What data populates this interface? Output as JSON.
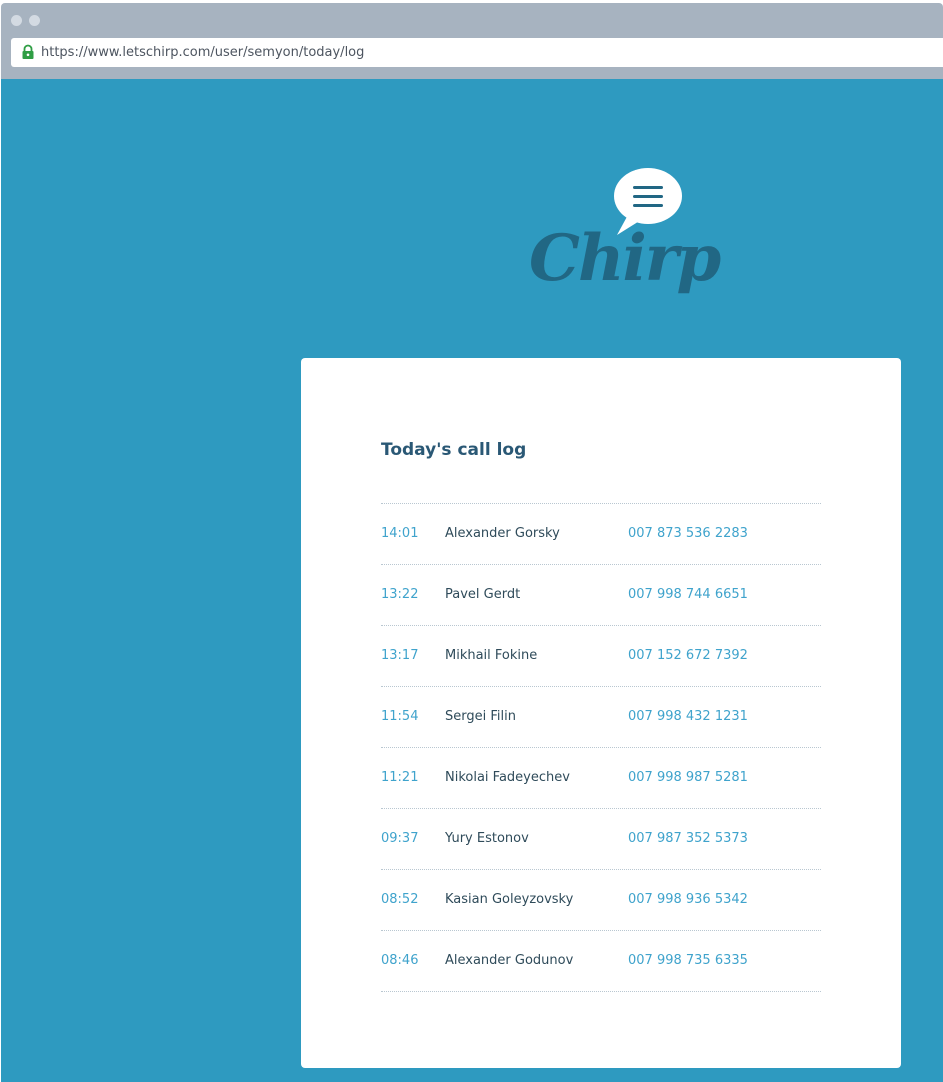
{
  "browser": {
    "url": "https://www.letschirp.com/user/semyon/today/log"
  },
  "logo": {
    "text": "Chirp"
  },
  "call_log": {
    "title": "Today's call log",
    "entries": [
      {
        "time": "14:01",
        "name": "Alexander Gorsky",
        "phone": "007 873 536 2283"
      },
      {
        "time": "13:22",
        "name": "Pavel Gerdt",
        "phone": "007 998 744 6651"
      },
      {
        "time": "13:17",
        "name": "Mikhail Fokine",
        "phone": "007 152 672 7392"
      },
      {
        "time": "11:54",
        "name": "Sergei Filin",
        "phone": "007 998 432 1231"
      },
      {
        "time": "11:21",
        "name": "Nikolai Fadeyechev",
        "phone": "007 998 987 5281"
      },
      {
        "time": "09:37",
        "name": "Yury Estonov",
        "phone": "007 987 352 5373"
      },
      {
        "time": "08:52",
        "name": "Kasian Goleyzovsky",
        "phone": "007 998 936 5342"
      },
      {
        "time": "08:46",
        "name": "Alexander Godunov",
        "phone": "007 998 735 6335"
      }
    ]
  },
  "colors": {
    "page_background": "#2e9ac0",
    "logo": "#216784",
    "accent_text": "#3fa3cc",
    "title_text": "#2a5875",
    "lock_icon": "#2f9e44"
  }
}
